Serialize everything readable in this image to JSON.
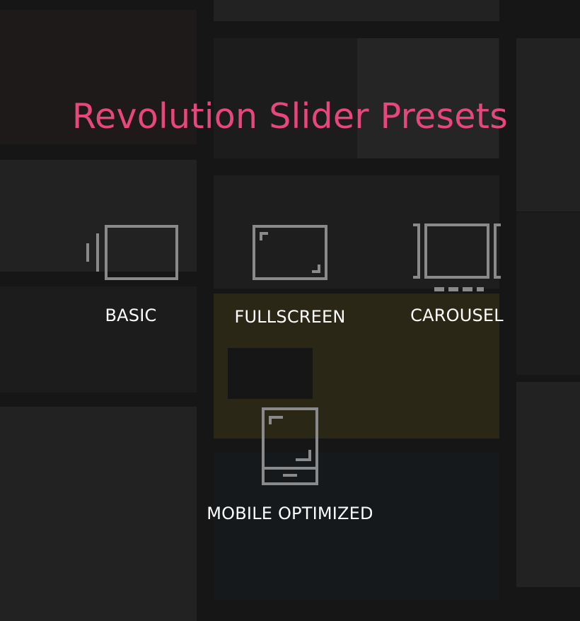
{
  "heading": {
    "title": "Revolution Slider Presets",
    "color": "#e8477e"
  },
  "icon_color": "#8a8a8a",
  "presets": [
    {
      "label": "BASIC",
      "icon": "basic-slider-icon"
    },
    {
      "label": "FULLSCREEN",
      "icon": "fullscreen-slider-icon"
    },
    {
      "label": "CAROUSEL",
      "icon": "carousel-slider-icon"
    },
    {
      "label": "MOBILE OPTIMIZED",
      "icon": "mobile-optimized-icon"
    }
  ]
}
